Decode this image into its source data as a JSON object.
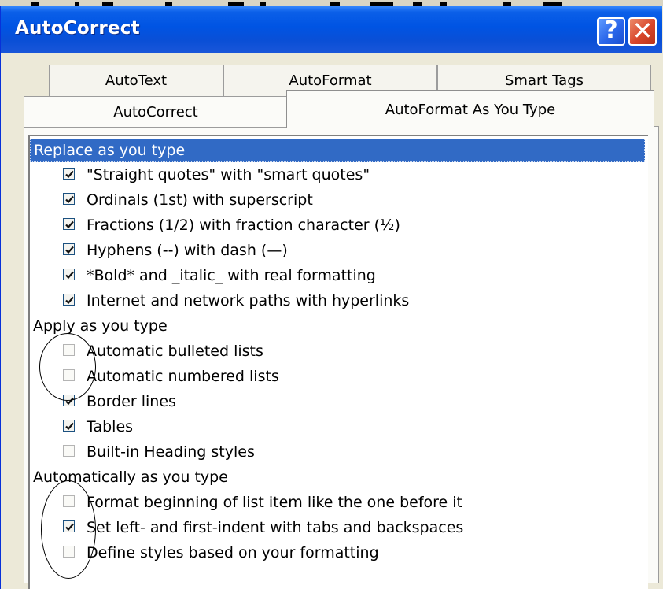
{
  "window": {
    "title": "AutoCorrect"
  },
  "titlebar_buttons": [
    {
      "name": "help-button",
      "glyph": "?"
    },
    {
      "name": "close-button",
      "glyph": "✕"
    }
  ],
  "tabs": {
    "back_row": [
      "AutoText",
      "AutoFormat",
      "Smart Tags"
    ],
    "front_row": [
      "AutoCorrect",
      "AutoFormat As You Type"
    ],
    "selected": "AutoFormat As You Type"
  },
  "sections": [
    {
      "heading": "Replace as you type",
      "selected": true,
      "items": [
        {
          "label": "\"Straight quotes\" with \"smart quotes\"",
          "checked": true
        },
        {
          "label": "Ordinals (1st) with superscript",
          "checked": true
        },
        {
          "label": "Fractions (1/2) with fraction character (½)",
          "checked": true
        },
        {
          "label": "Hyphens (--) with dash (—)",
          "checked": true
        },
        {
          "label": "*Bold* and _italic_ with real formatting",
          "checked": true
        },
        {
          "label": "Internet and network paths with hyperlinks",
          "checked": true
        }
      ]
    },
    {
      "heading": "Apply as you type",
      "selected": false,
      "items": [
        {
          "label": "Automatic bulleted lists",
          "checked": false
        },
        {
          "label": "Automatic numbered lists",
          "checked": false
        },
        {
          "label": "Border lines",
          "checked": true
        },
        {
          "label": "Tables",
          "checked": true
        },
        {
          "label": "Built-in Heading styles",
          "checked": false
        }
      ]
    },
    {
      "heading": "Automatically as you type",
      "selected": false,
      "items": [
        {
          "label": "Format beginning of list item like the one before it",
          "checked": false
        },
        {
          "label": "Set left- and first-indent with tabs and backspaces",
          "checked": true
        },
        {
          "label": "Define styles based on your formatting",
          "checked": false
        }
      ]
    }
  ],
  "colors": {
    "titlebar": "#0054e3",
    "selection": "#316ac5",
    "dialog_bg": "#ece9d8",
    "close_button": "#d8452a",
    "check_mark": "#21a121"
  }
}
